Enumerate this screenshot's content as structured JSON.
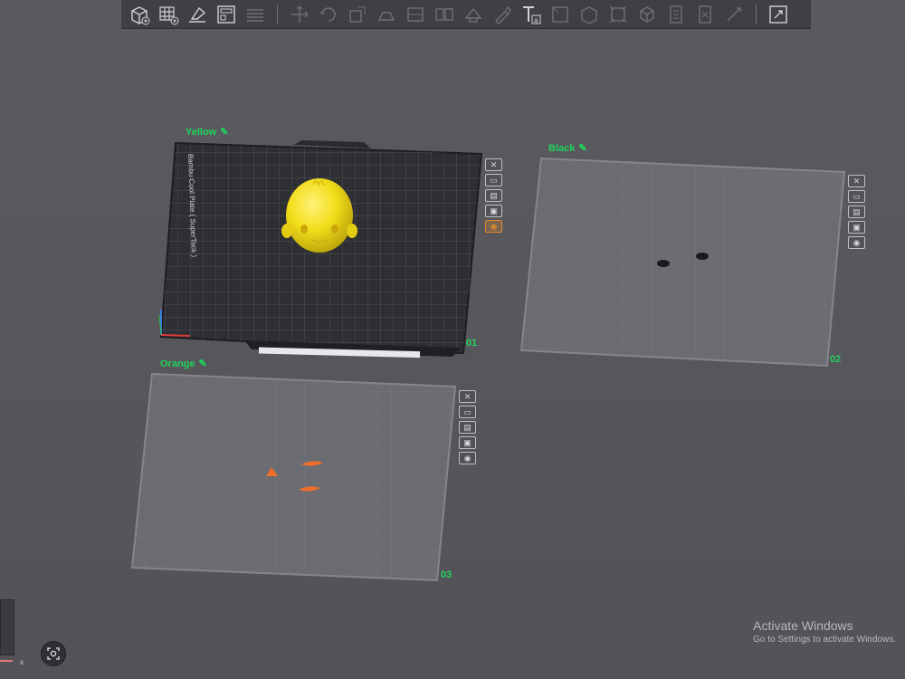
{
  "toolbar": {
    "groups": [
      [
        "add-cube-icon",
        "add-plate-icon",
        "orient-icon",
        "arrange-icon",
        "layers-icon"
      ],
      [
        "move-icon",
        "rotate-icon",
        "scale-icon",
        "lay-on-face-icon",
        "cut-icon",
        "split-objects-icon",
        "split-parts-icon",
        "support-paint-icon",
        "seam-paint-icon"
      ],
      [
        "text-icon",
        "color-paint-icon",
        "measure-icon",
        "assembly-icon",
        "boolean-icon",
        "variable-layer-icon",
        "advanced-icon",
        "brim-ears-icon"
      ],
      [
        "view-mode-icon"
      ]
    ],
    "text_tool_glyph": "Ta"
  },
  "plates": [
    {
      "name": "Yellow",
      "index": "01",
      "bed_text": "Bambu Cool Plate ( SuperTack )"
    },
    {
      "name": "Black",
      "index": "02"
    },
    {
      "name": "Orange",
      "index": "03"
    }
  ],
  "edit_glyph": "✎",
  "colors": {
    "label_green": "#1fd35a",
    "yellow_object": "#f2dd1a",
    "orange_object": "#ef6f2a",
    "black_object": "#1a1a1a",
    "active_plate_bed": "#2e2f33"
  },
  "activate": {
    "title": "Activate Windows",
    "subtitle": "Go to Settings to activate Windows."
  },
  "bottom_button_icon": "focus-icon",
  "axis_label": "x"
}
